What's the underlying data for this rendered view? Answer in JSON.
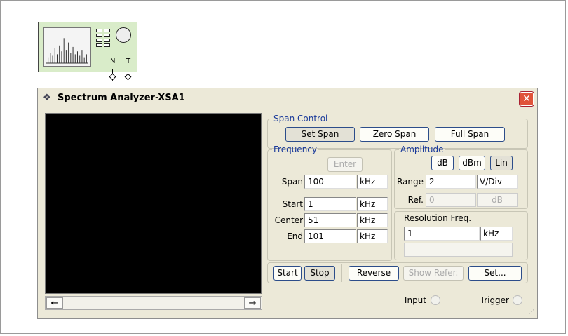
{
  "instrument": {
    "pin_in": "IN",
    "pin_trigger": "T",
    "spectrum_bar_heights": [
      0.2,
      0.35,
      0.25,
      0.5,
      0.3,
      0.6,
      0.4,
      0.85,
      0.45,
      0.7,
      0.35,
      0.55,
      0.3,
      0.4,
      0.25,
      0.45,
      0.2,
      0.3
    ]
  },
  "window": {
    "icon": "spectrum-analyzer-icon",
    "title": "Spectrum Analyzer-XSA1",
    "close_glyph": "✕"
  },
  "display": {
    "scroll_left": "←",
    "scroll_right": "→"
  },
  "span_control": {
    "legend": "Span Control",
    "set_span": "Set Span",
    "zero_span": "Zero Span",
    "full_span": "Full Span"
  },
  "frequency": {
    "legend": "Frequency",
    "enter": "Enter",
    "span_label": "Span",
    "span_value": "100",
    "span_unit": "kHz",
    "start_label": "Start",
    "start_value": "1",
    "start_unit": "kHz",
    "center_label": "Center",
    "center_value": "51",
    "center_unit": "kHz",
    "end_label": "End",
    "end_value": "101",
    "end_unit": "kHz"
  },
  "amplitude": {
    "legend": "Amplitude",
    "db": "dB",
    "dbm": "dBm",
    "lin": "Lin",
    "range_label": "Range",
    "range_value": "2",
    "range_unit": "V/Div",
    "ref_label": "Ref.",
    "ref_value": "0",
    "ref_unit": "dB"
  },
  "resolution": {
    "label": "Resolution Freq.",
    "value": "1",
    "unit": "kHz"
  },
  "controls": {
    "start": "Start",
    "stop": "Stop",
    "reverse": "Reverse",
    "show_refer": "Show Refer.",
    "set": "Set..."
  },
  "indicators": {
    "input": "Input",
    "trigger": "Trigger"
  }
}
